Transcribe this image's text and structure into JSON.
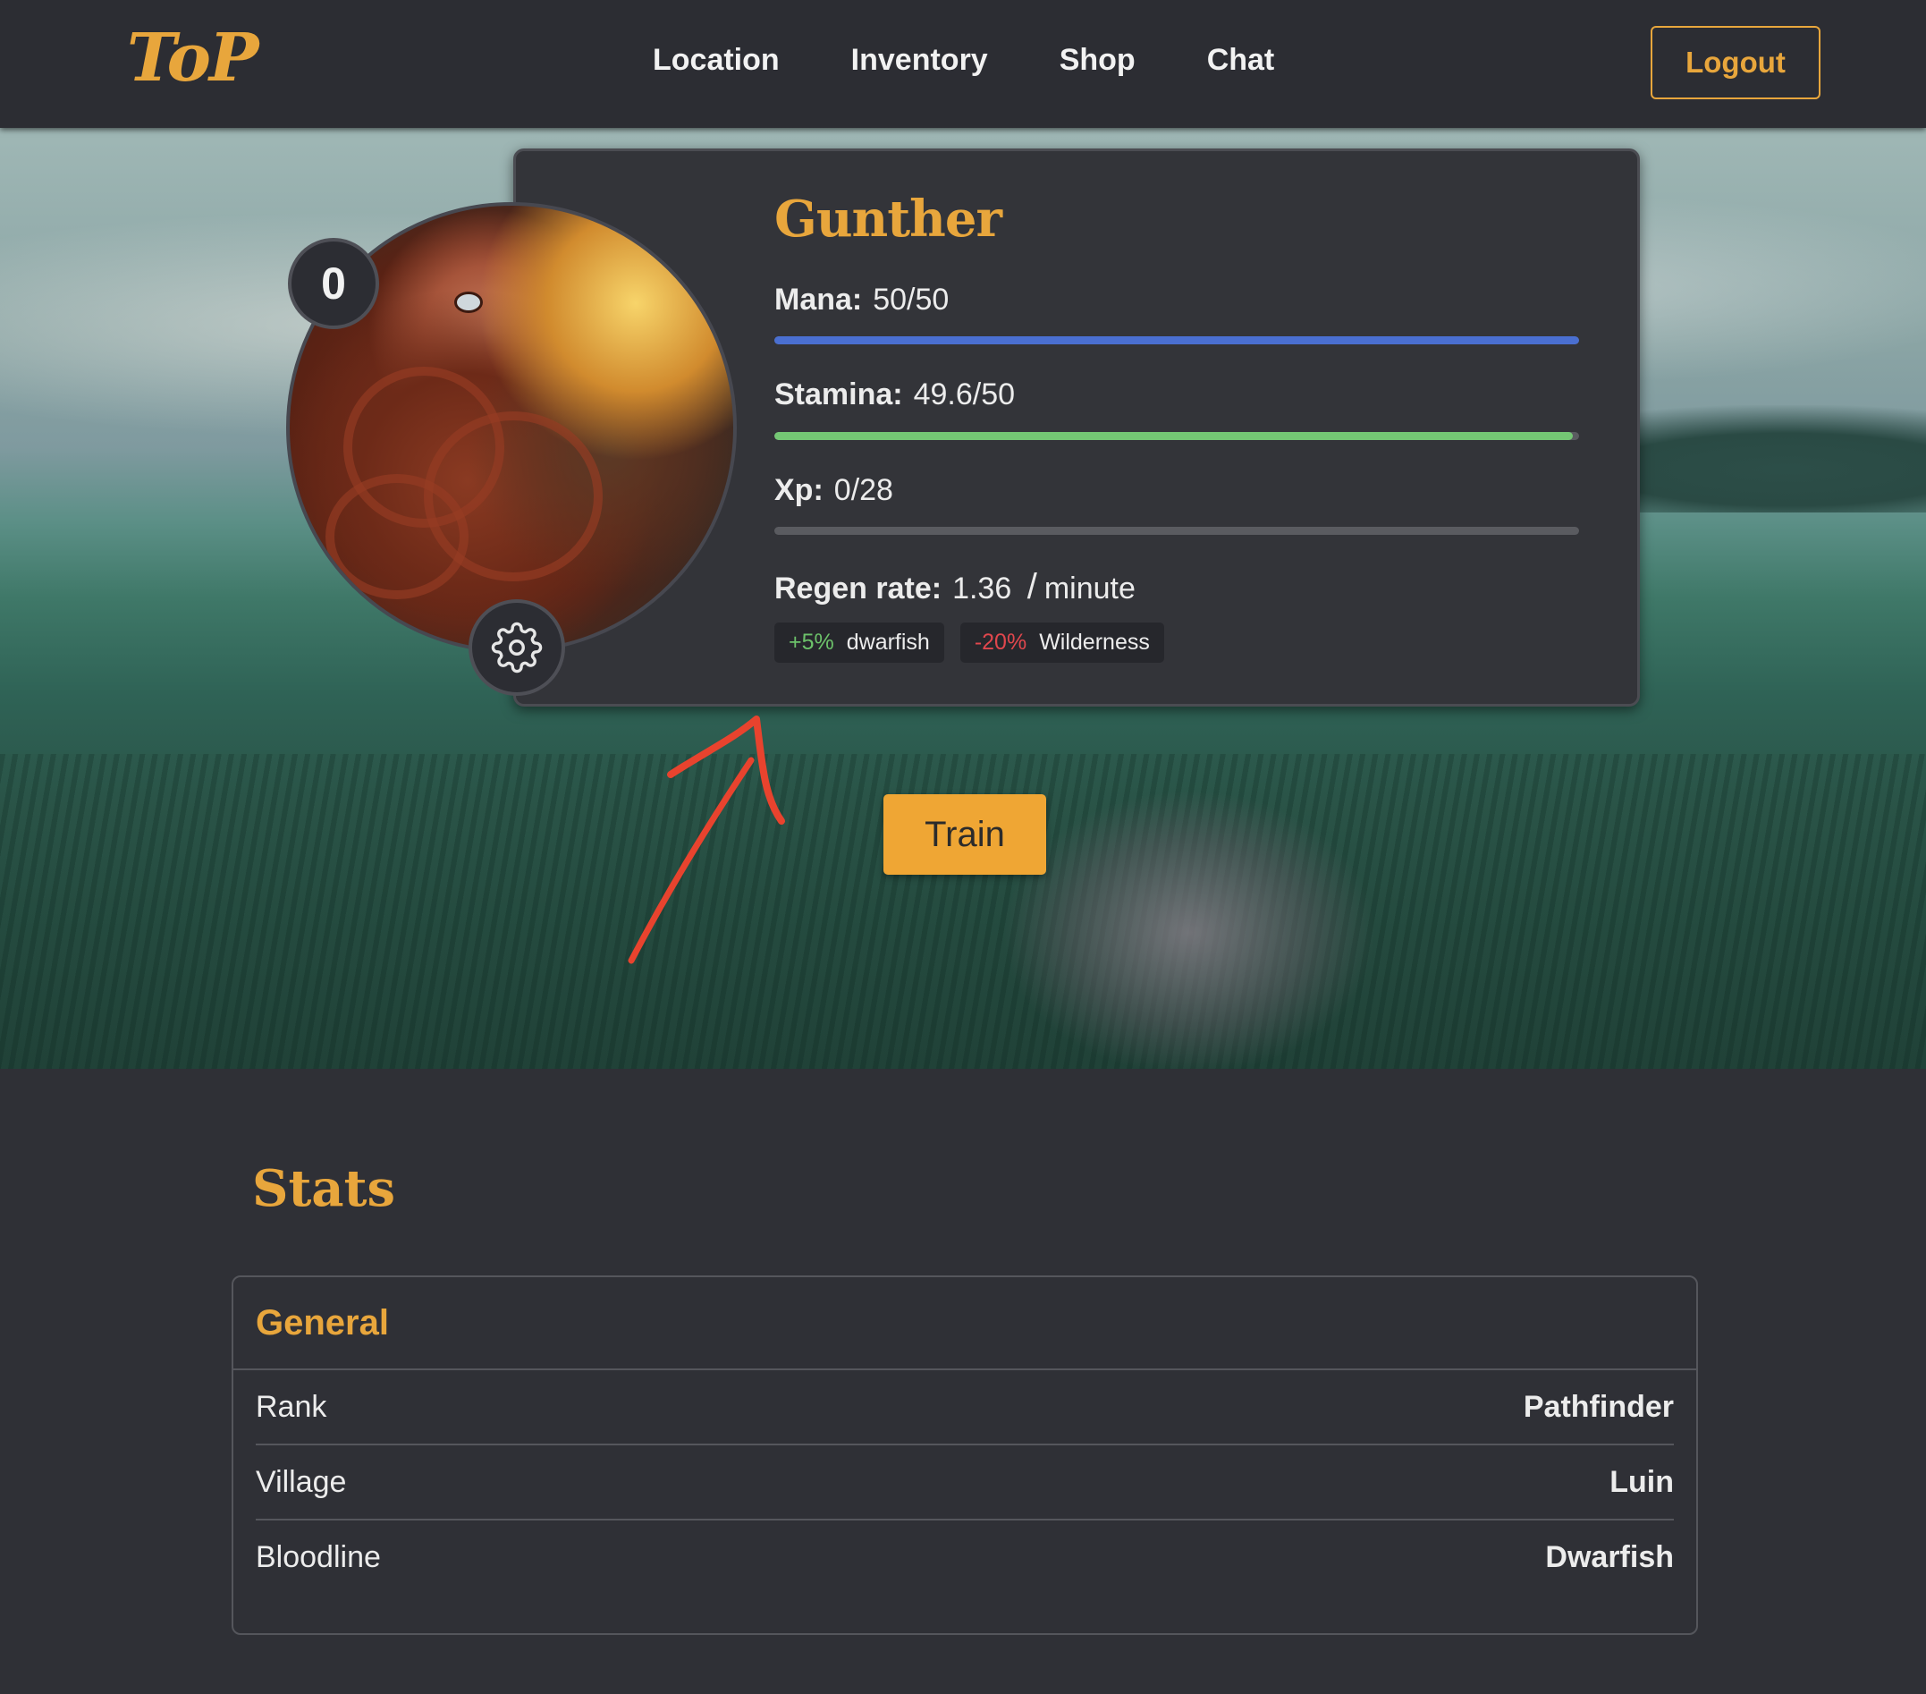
{
  "app": {
    "logo": "ToP"
  },
  "nav": {
    "items": [
      "Location",
      "Inventory",
      "Shop",
      "Chat"
    ],
    "logout": "Logout"
  },
  "character": {
    "name": "Gunther",
    "level": "0",
    "mana": {
      "label": "Mana:",
      "value": "50/50",
      "fraction": 1.0,
      "color": "#4a6fd1"
    },
    "stamina": {
      "label": "Stamina:",
      "value": "49.6/50",
      "fraction": 0.992,
      "color": "#74c774"
    },
    "xp": {
      "label": "Xp:",
      "value": "0/28",
      "fraction": 0.0,
      "color": "#74c774"
    },
    "regen": {
      "label": "Regen rate:",
      "value": "1.36",
      "slash": "/",
      "unit": "minute"
    },
    "modifiers": [
      {
        "amount": "+5%",
        "name": "dwarfish",
        "type": "positive"
      },
      {
        "amount": "-20%",
        "name": "Wilderness",
        "type": "negative"
      }
    ]
  },
  "actions": {
    "train": "Train"
  },
  "stats": {
    "title": "Stats",
    "general": {
      "title": "General",
      "rows": [
        {
          "label": "Rank",
          "value": "Pathfinder"
        },
        {
          "label": "Village",
          "value": "Luin"
        },
        {
          "label": "Bloodline",
          "value": "Dwarfish"
        }
      ]
    }
  },
  "colors": {
    "accent": "#e8a63c",
    "annotation_arrow": "#e8432e",
    "background": "#2f3036"
  },
  "icons": {
    "settings": "gear-icon",
    "annotation": "red-arrow-icon"
  }
}
